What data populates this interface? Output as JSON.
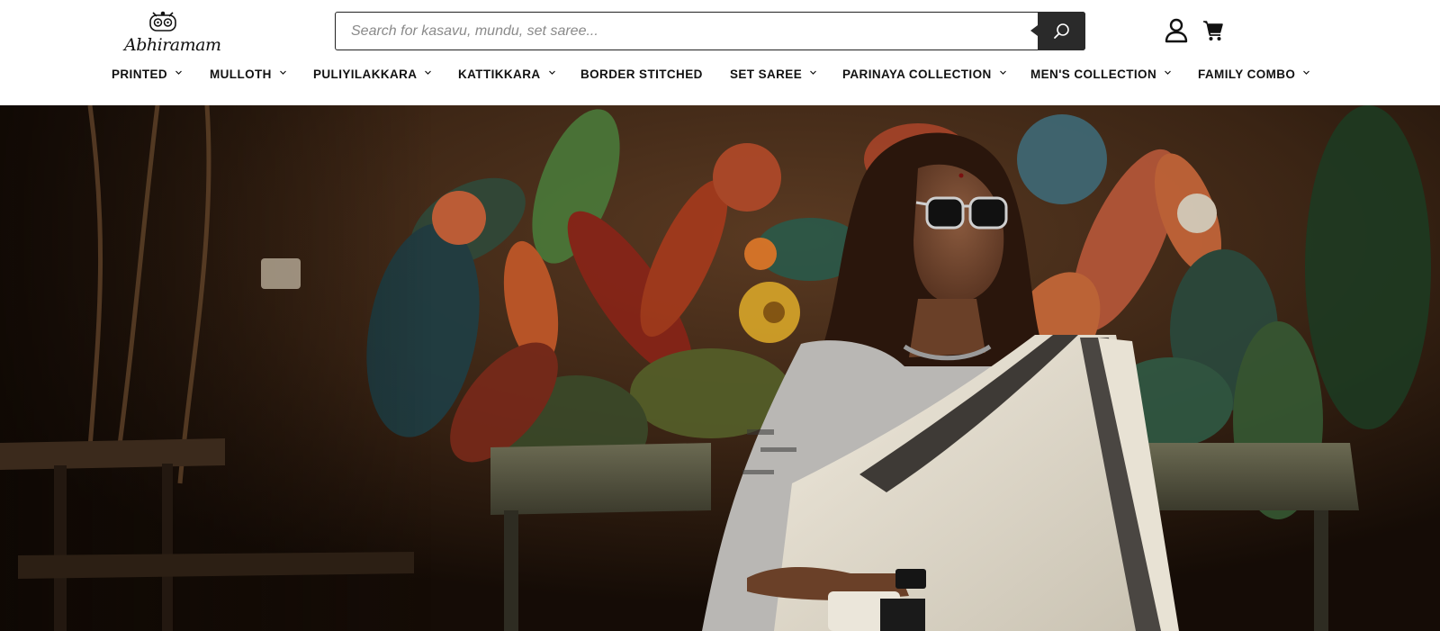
{
  "brand": {
    "name": "Abhiramam"
  },
  "search": {
    "placeholder": "Search for kasavu, mundu, set saree..."
  },
  "icons": {
    "logo": "owl-logo-icon",
    "search": "search-icon",
    "account": "user-icon",
    "cart": "cart-icon",
    "chevron": "chevron-down-icon"
  },
  "nav": {
    "items": [
      {
        "label": "PRINTED",
        "has_dropdown": true
      },
      {
        "label": "MULLOTH",
        "has_dropdown": true
      },
      {
        "label": "PULIYILAKKARA",
        "has_dropdown": true
      },
      {
        "label": "KATTIKKARA",
        "has_dropdown": true
      },
      {
        "label": "BORDER STITCHED",
        "has_dropdown": false
      },
      {
        "label": "SET SAREE",
        "has_dropdown": true
      },
      {
        "label": "PARINAYA COLLECTION",
        "has_dropdown": true
      },
      {
        "label": "MEN'S COLLECTION",
        "has_dropdown": true
      },
      {
        "label": "FAMILY COMBO",
        "has_dropdown": true
      }
    ]
  },
  "colors": {
    "search_button": "#2a2a2a",
    "text": "#111111",
    "background": "#ffffff"
  }
}
